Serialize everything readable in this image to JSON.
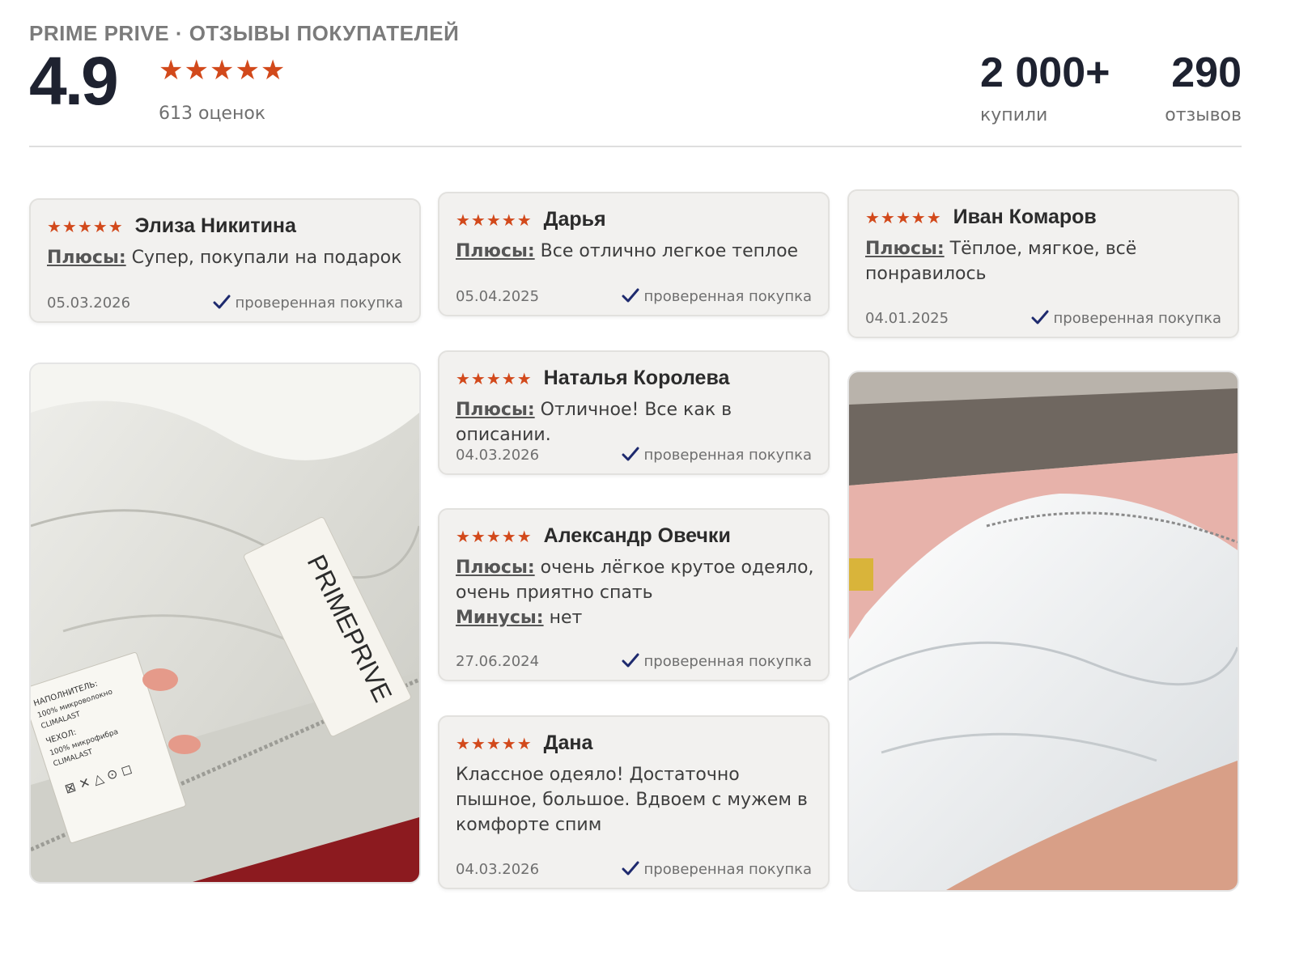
{
  "header": {
    "brand": "PRIME PRIVE · ОТЗЫВЫ ПОКУПАТЕЛЕЙ",
    "rating": "4.9",
    "stars": "★★★★★",
    "rating_count": "613 оценок",
    "bought_value": "2 000+",
    "bought_label": "купили",
    "reviews_value": "290",
    "reviews_label": "отзывов"
  },
  "colors": {
    "star": "#d2491b",
    "check": "#1e2a6e",
    "card_bg": "#f2f1ef"
  },
  "labels": {
    "pros": "Плюсы:",
    "cons": "Минусы:",
    "verified": "проверенная покупка"
  },
  "reviews": [
    {
      "name": "Элиза Никитина",
      "stars": "★★★★★",
      "pros": "Супер, покупали на подарок",
      "date": "05.03.2026"
    },
    {
      "name": "Дарья",
      "stars": "★★★★★",
      "pros": "Все отлично легкое теплое",
      "date": "05.04.2025"
    },
    {
      "name": "Иван Комаров",
      "stars": "★★★★★",
      "pros": "Тёплое, мягкое, всё понравилось",
      "date": "04.01.2025"
    },
    {
      "name": "Наталья Королева",
      "stars": "★★★★★",
      "pros": "Отличное! Все как в описании.",
      "date": "04.03.2026"
    },
    {
      "name": "Александр Овечки",
      "stars": "★★★★★",
      "pros": "очень лёгкое крутое одеяло, очень приятно спать",
      "cons": "нет",
      "date": "27.06.2024"
    },
    {
      "name": "Дана",
      "stars": "★★★★★",
      "text": "Классное одеяло! Достаточно пышное, большое. Вдвоем с мужем в комфорте спим",
      "date": "04.03.2026"
    }
  ],
  "photos": {
    "label_brand": "PRIMEPRIVE",
    "tag_lines": [
      "НАПОЛНИТЕЛЬ:",
      "100% микроволокно",
      "CLIMALAST",
      "ЧЕХОЛ:",
      "100% микрофибра",
      "CLIMALAST"
    ]
  }
}
